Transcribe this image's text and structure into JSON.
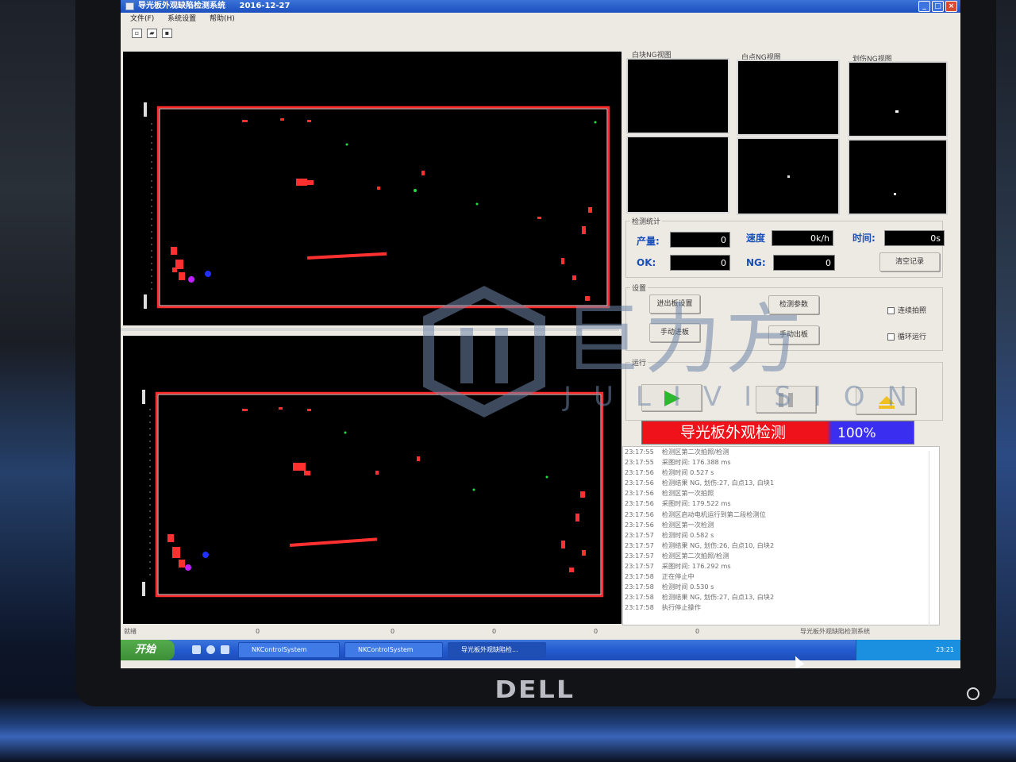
{
  "window": {
    "title": "导光板外观缺陷检测系统",
    "date": "2016-12-27",
    "controls": [
      "_",
      "□",
      "×"
    ]
  },
  "menu": [
    "文件(F)",
    "系统设置",
    "帮助(H)"
  ],
  "toolbar_icons": [
    "new-icon",
    "open-icon",
    "save-icon"
  ],
  "views": {
    "labels": [
      "白块NG视图",
      "白点NG视图",
      "划伤NG视图"
    ]
  },
  "stats": {
    "group_label": "检测统计",
    "output_label": "产量:",
    "output_value": "0",
    "speed_label": "速度",
    "speed_value": "0k/h",
    "time_label": "时间:",
    "time_value": "0s",
    "ok_label": "OK:",
    "ok_value": "0",
    "ng_label": "NG:",
    "ng_value": "0",
    "clear_button": "清空记录"
  },
  "settings": {
    "group_label": "设置",
    "in_out_button": "进出板设置",
    "params_button": "检测参数",
    "manual_in_button": "手动进板",
    "manual_out_button": "手动出板",
    "continuous_label": "连续拍照",
    "loop_label": "循环运行"
  },
  "run": {
    "group_label": "运行",
    "play_icon": "play-icon",
    "pause_icon": "pause-icon",
    "eject_icon": "eject-icon",
    "banner_text": "导光板外观检测",
    "progress": "100%",
    "colors": {
      "banner": "#f0121a",
      "progress": "#3a2ef0"
    }
  },
  "log": [
    {
      "time": "23:17:55",
      "msg": "检测区第二次拍照/检测"
    },
    {
      "time": "23:17:55",
      "msg": "采图时间: 176.388 ms"
    },
    {
      "time": "23:17:56",
      "msg": "检测时间 0.527 s"
    },
    {
      "time": "23:17:56",
      "msg": "检测结果 NG, 划伤:27, 白点13, 白块1"
    },
    {
      "time": "23:17:56",
      "msg": "检测区第一次拍照"
    },
    {
      "time": "23:17:56",
      "msg": "采图时间: 179.522 ms"
    },
    {
      "time": "23:17:56",
      "msg": "检测区启动电机运行到第二段检测位"
    },
    {
      "time": "23:17:56",
      "msg": "检测区第一次检测"
    },
    {
      "time": "23:17:57",
      "msg": "检测时间 0.582 s"
    },
    {
      "time": "23:17:57",
      "msg": "检测结果 NG, 划伤:26, 白点10, 白块2"
    },
    {
      "time": "23:17:57",
      "msg": "检测区第二次拍照/检测"
    },
    {
      "time": "23:17:57",
      "msg": "采图时间: 176.292 ms"
    },
    {
      "time": "23:17:58",
      "msg": "正在停止中"
    },
    {
      "time": "23:17:58",
      "msg": "检测时间 0.530 s"
    },
    {
      "time": "23:17:58",
      "msg": "检测结果 NG, 划伤:27, 白点13, 白块2"
    },
    {
      "time": "23:17:58",
      "msg": "执行停止操作"
    }
  ],
  "statusbar": {
    "ready": "就绪",
    "fields": [
      "0",
      "0",
      "0",
      "0",
      "0"
    ],
    "app_name": "导光板外观缺陷检测系统"
  },
  "taskbar": {
    "start": "开始",
    "tasks": [
      "NKControlSystem",
      "NKControlSystem",
      "导光板外观缺陷检..."
    ],
    "clock": "23:21"
  },
  "watermark": {
    "text": "巨力方",
    "sub": "JULIVISION"
  },
  "monitor": {
    "brand": "DELL"
  }
}
